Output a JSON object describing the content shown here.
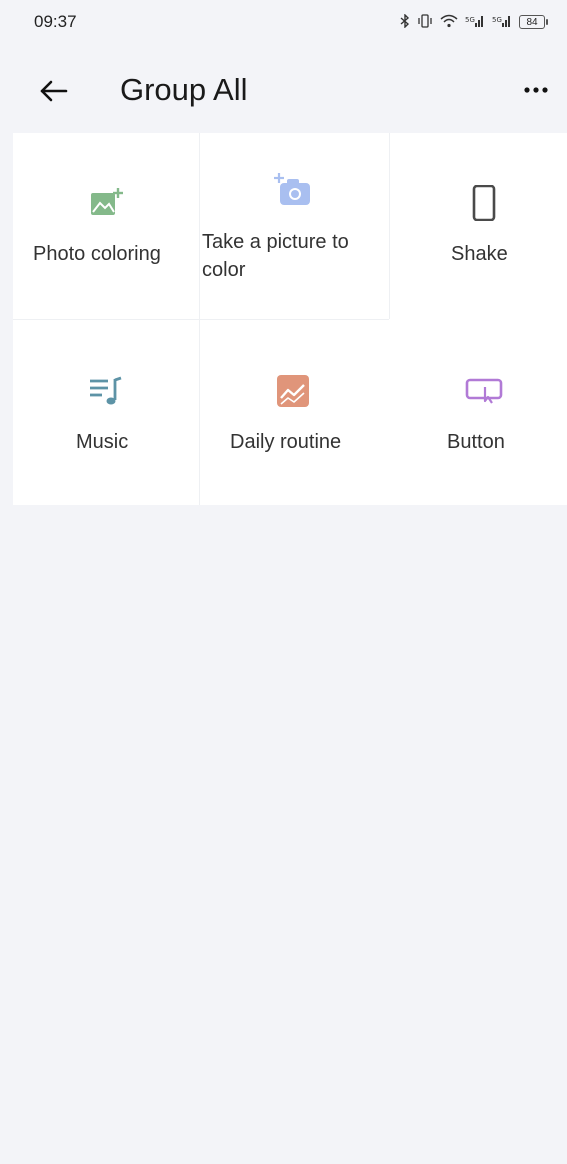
{
  "status_bar": {
    "time": "09:37",
    "battery": "84",
    "icons": [
      "bluetooth-icon",
      "vibrate-icon",
      "wifi-icon",
      "signal-icon",
      "signal-icon",
      "battery-icon"
    ]
  },
  "header": {
    "title": "Group All",
    "back_icon": "arrow-left-icon",
    "more_icon": "more-horizontal-icon"
  },
  "modes": [
    {
      "label": "Photo coloring",
      "icon": "image-add-icon",
      "color": "#84b98a"
    },
    {
      "label": "Take a picture to color",
      "label_line1": "Take a picture to",
      "label_line2": "color",
      "icon": "camera-add-icon",
      "color": "#a9bff0"
    },
    {
      "label": "Shake",
      "icon": "phone-icon",
      "color": "#4a4a4a"
    },
    {
      "label": "Music",
      "icon": "music-list-icon",
      "color": "#5d93a6"
    },
    {
      "label": "Daily routine",
      "icon": "daily-routine-icon",
      "color": "#e0957a"
    },
    {
      "label": "Button",
      "icon": "button-press-icon",
      "color": "#b17ad6"
    }
  ],
  "colors": {
    "background": "#f3f4f8",
    "card": "#ffffff",
    "text": "#333333"
  }
}
